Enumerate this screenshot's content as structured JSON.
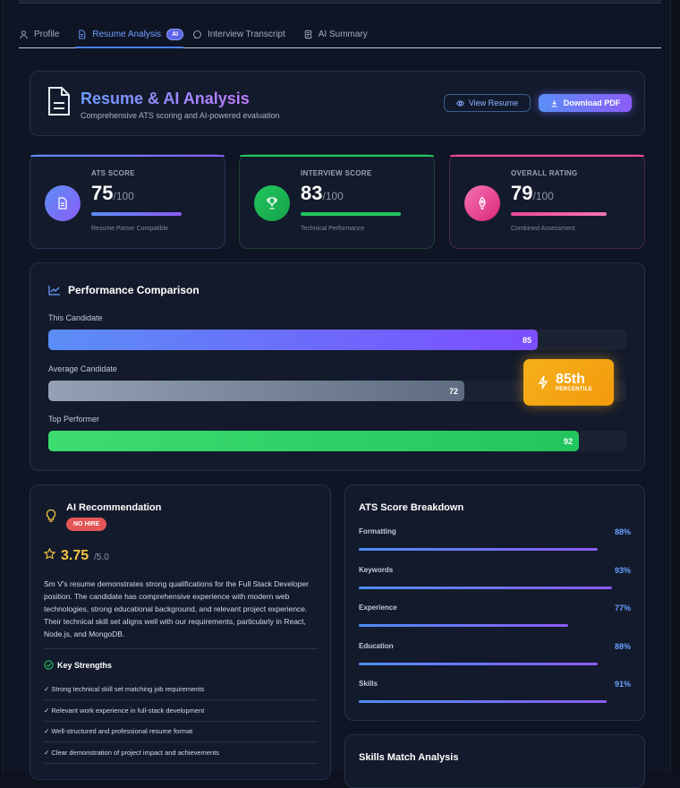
{
  "tabs": [
    {
      "label": "Profile",
      "icon": "person-icon"
    },
    {
      "label": "Resume Analysis",
      "icon": "document-icon",
      "badge": "AI",
      "active": true
    },
    {
      "label": "Interview Transcript",
      "icon": "chat-bubble-icon"
    },
    {
      "label": "AI Summary",
      "icon": "summary-doc-icon"
    }
  ],
  "header": {
    "title": "Resume & AI Analysis",
    "subtitle": "Comprehensive ATS scoring and AI-powered evaluation",
    "view_resume": "View Resume",
    "download_pdf": "Download PDF"
  },
  "scores": [
    {
      "label": "ATS SCORE",
      "value": "75",
      "max": "/100",
      "caption": "Resume Parser Compatible",
      "fill": 0.75,
      "color": "#5b8ef6",
      "icon": "document-icon"
    },
    {
      "label": "INTERVIEW SCORE",
      "value": "83",
      "max": "/100",
      "caption": "Technical Performance",
      "fill": 0.83,
      "color": "#22c55e",
      "icon": "trophy-icon"
    },
    {
      "label": "OVERALL RATING",
      "value": "79",
      "max": "/100",
      "caption": "Combined Assessment",
      "fill": 0.79,
      "color": "#ec4899",
      "icon": "rocket-icon"
    }
  ],
  "performance": {
    "title": "Performance Comparison",
    "rows": [
      {
        "label": "This Candidate",
        "value": "85",
        "fraction": 0.85
      },
      {
        "label": "Average Candidate",
        "value": "72",
        "fraction": 0.72
      },
      {
        "label": "Top Performer",
        "value": "92",
        "fraction": 0.92
      }
    ],
    "percentile": "85th",
    "percentile_label": "PERCENTILE"
  },
  "recommendation": {
    "title": "AI Recommendation",
    "badge": "NO HIRE",
    "rating": "3.75",
    "rating_max": "/5.0",
    "text": "Sm V's resume demonstrates strong qualifications for the Full Stack Developer position. The candidate has comprehensive experience with modern web technologies, strong educational background, and relevant project experience. Their technical skill set aligns well with our requirements, particularly in React, Node.js, and MongoDB.",
    "strengths_title": "Key Strengths",
    "strengths": [
      "✓ Strong technical skill set matching job requirements",
      "✓ Relevant work experience in full-stack development",
      "✓ Well-structured and professional resume format",
      "✓ Clear demonstration of project impact and achievements"
    ]
  },
  "ats_breakdown": {
    "title": "ATS Score Breakdown",
    "items": [
      {
        "label": "Formatting",
        "pct": "88%",
        "fraction": 0.88
      },
      {
        "label": "Keywords",
        "pct": "93%",
        "fraction": 0.93
      },
      {
        "label": "Experience",
        "pct": "77%",
        "fraction": 0.77
      },
      {
        "label": "Education",
        "pct": "88%",
        "fraction": 0.88
      },
      {
        "label": "Skills",
        "pct": "91%",
        "fraction": 0.91
      }
    ]
  },
  "skills_match": {
    "title": "Skills Match Analysis"
  }
}
